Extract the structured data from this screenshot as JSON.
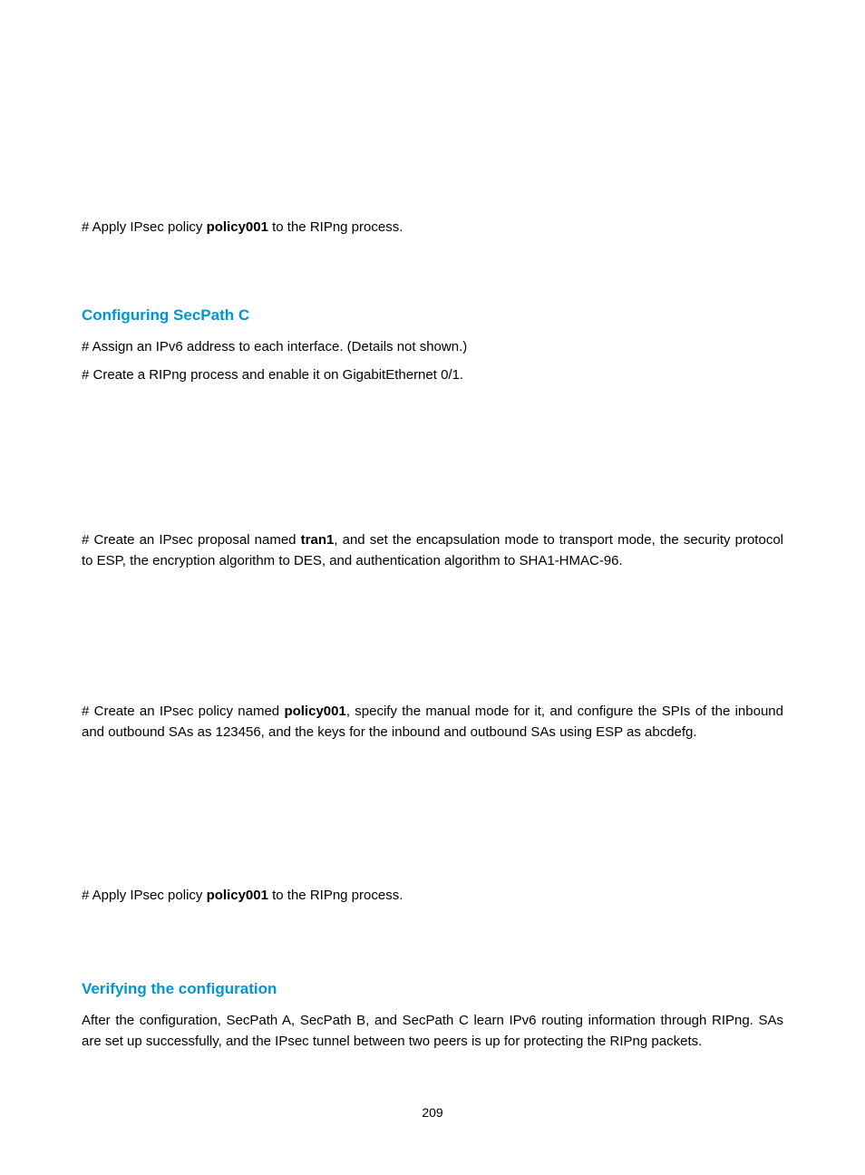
{
  "para1_pre": "# Apply IPsec policy ",
  "para1_b": "policy001",
  "para1_post": " to the RIPng process.",
  "heading1": "Configuring SecPath C",
  "cfg_p1": "# Assign an IPv6 address to each interface. (Details not shown.)",
  "cfg_p2": "# Create a RIPng process and enable it on GigabitEthernet 0/1.",
  "cfg_p3_pre": "# Create an IPsec proposal named ",
  "cfg_p3_b": "tran1",
  "cfg_p3_post": ", and set the encapsulation mode to transport mode, the security protocol to ESP, the encryption algorithm to DES, and authentication algorithm to SHA1-HMAC-96.",
  "cfg_p4_pre": "# Create an IPsec policy named ",
  "cfg_p4_b": "policy001",
  "cfg_p4_post": ", specify the manual mode for it, and configure the SPIs of the inbound and outbound SAs as 123456, and the keys for the inbound and outbound SAs using ESP as abcdefg.",
  "cfg_p5_pre": "# Apply IPsec policy ",
  "cfg_p5_b": "policy001",
  "cfg_p5_post": " to the RIPng process.",
  "heading2": "Verifying the configuration",
  "verify_p1": "After the configuration, SecPath A, SecPath B, and SecPath C learn IPv6 routing information through RIPng. SAs are set up successfully, and the IPsec tunnel between two peers is up for protecting the RIPng packets.",
  "page_number": "209"
}
